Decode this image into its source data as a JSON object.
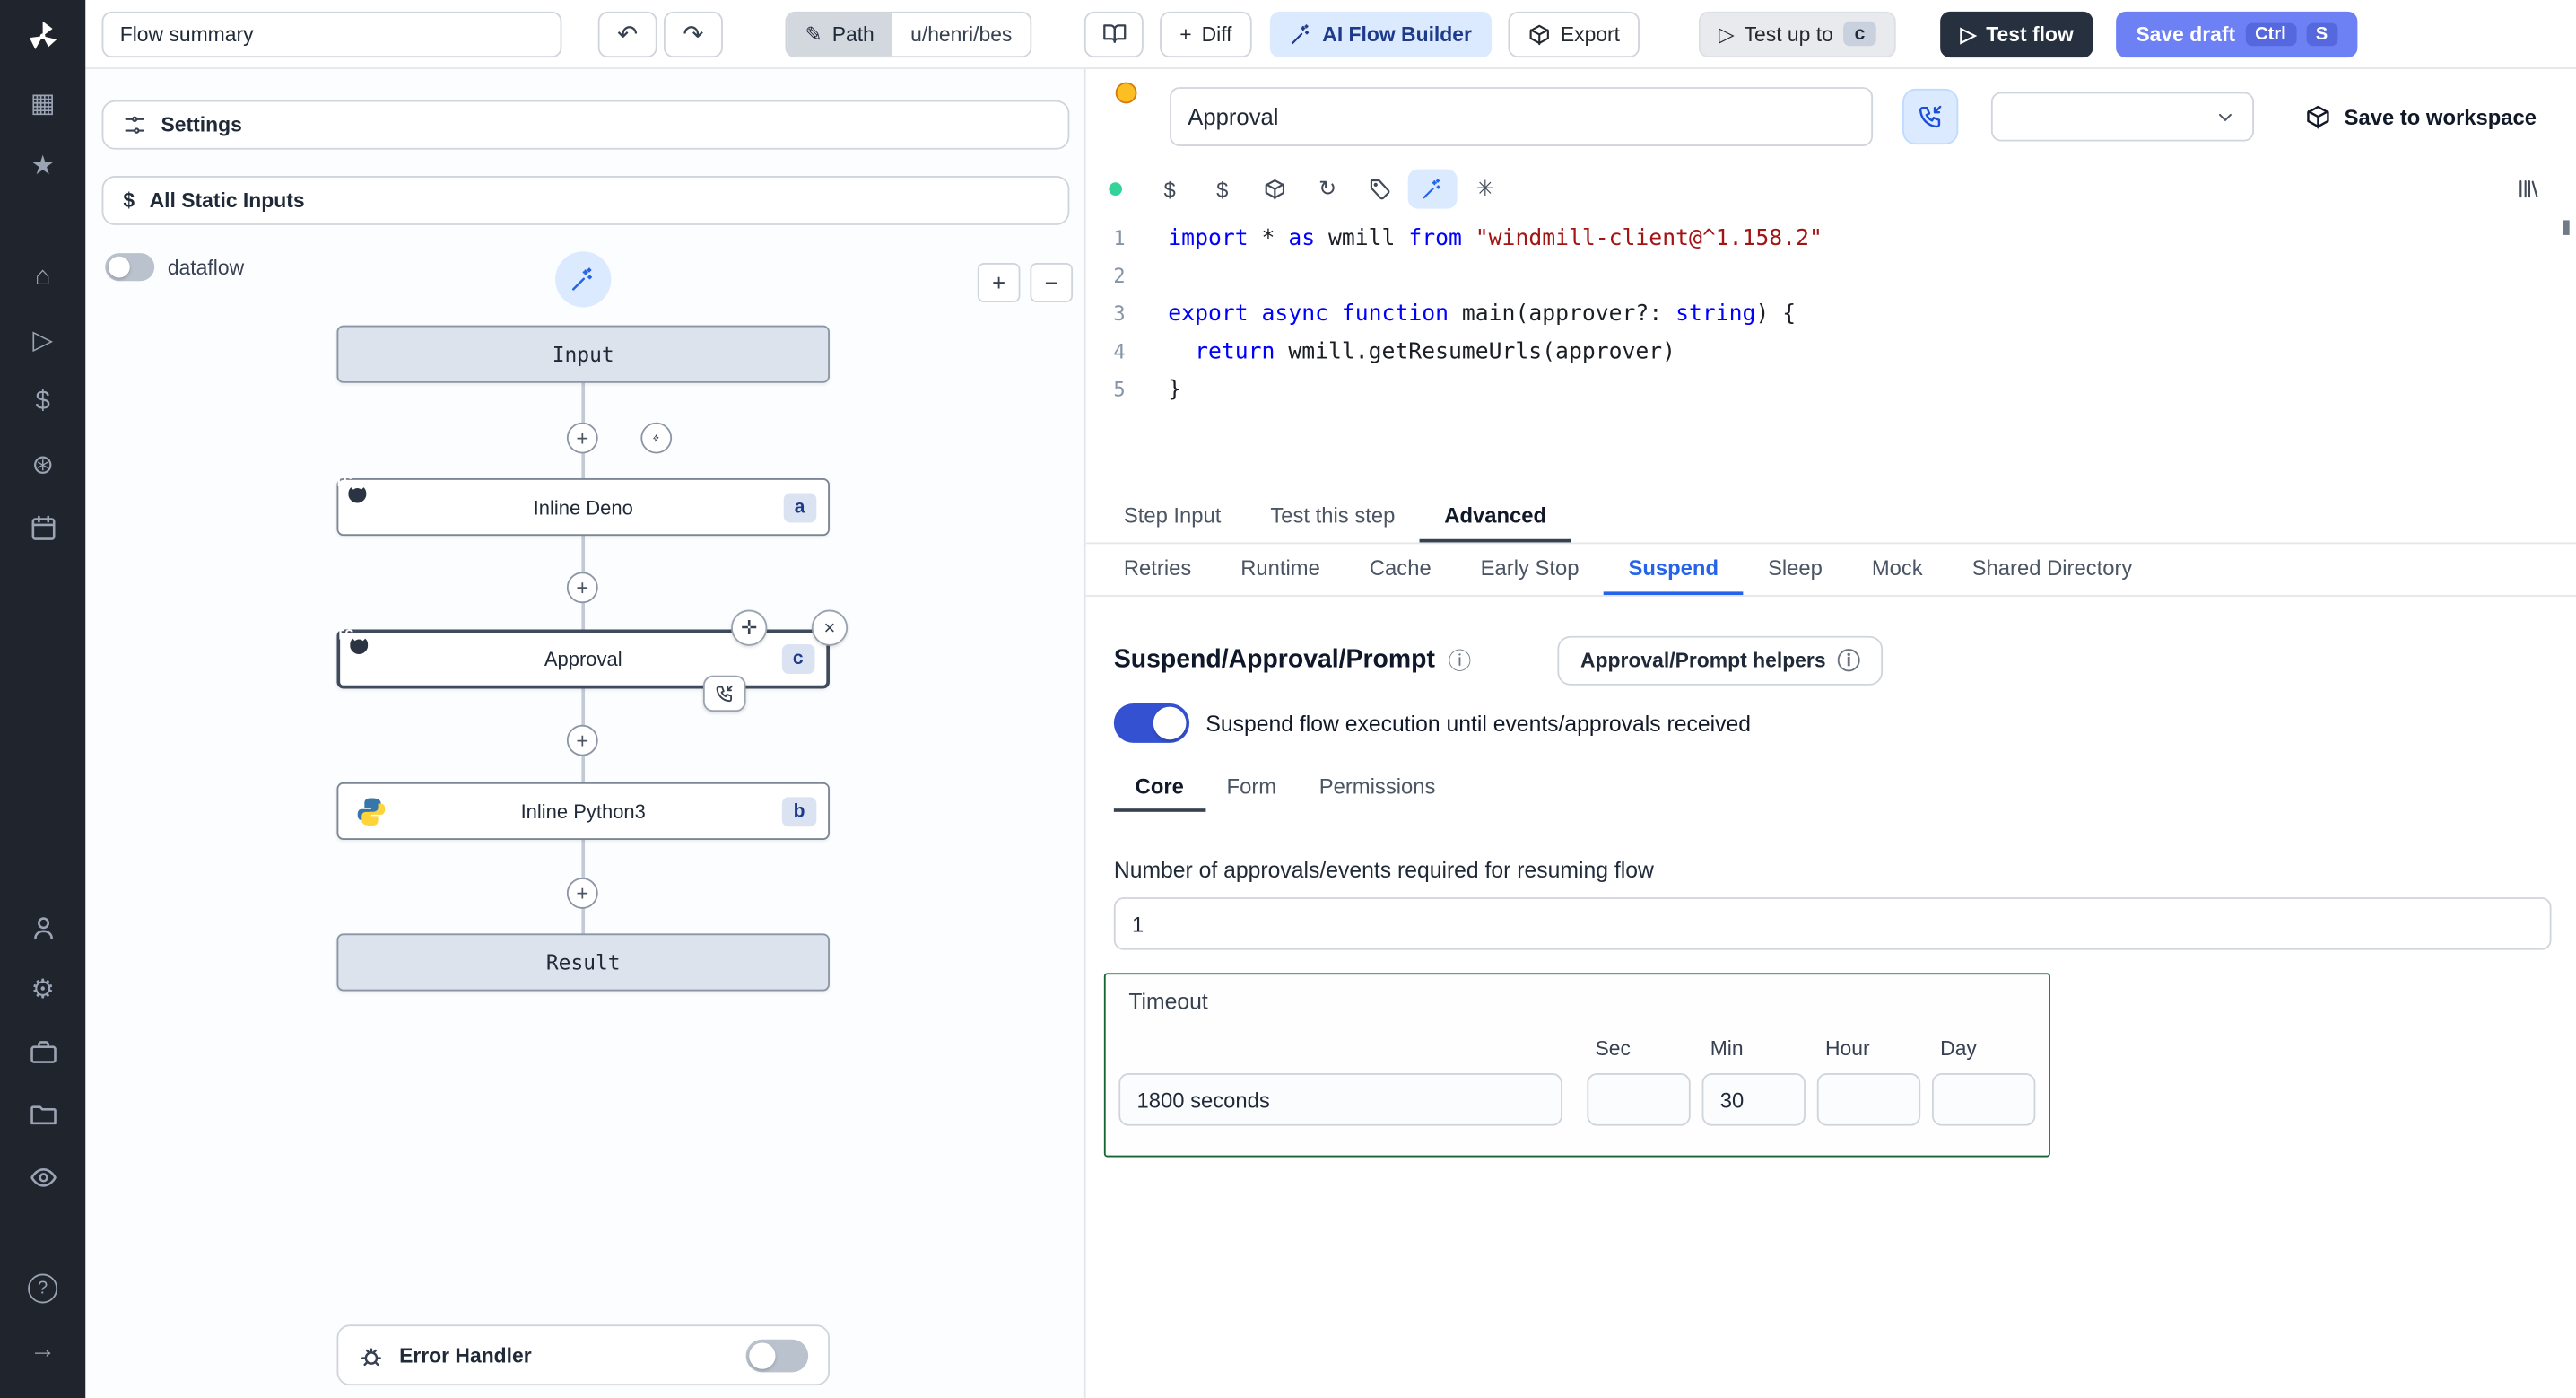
{
  "icons": {
    "undo": "↶",
    "redo": "↷",
    "pencil": "✎",
    "plus": "+",
    "minus": "−",
    "close": "×",
    "move": "✛",
    "grid": "▦",
    "star": "★",
    "home": "⌂",
    "play": "▷",
    "dollar": "$",
    "hub": "⊛",
    "gear": "⚙",
    "help": "?",
    "arrow_right": "→",
    "refresh": "↻",
    "asterisk": "✳",
    "info": "ⓘ",
    "ts": "TS"
  },
  "topbar": {
    "flow_summary": "Flow summary",
    "path_label": "Path",
    "path_value": "u/henri/bes",
    "diff_label": "Diff",
    "ai_builder_label": "AI Flow Builder",
    "export_label": "Export",
    "test_up_to_label": "Test up to",
    "test_up_to_badge": "c",
    "test_flow_label": "Test flow",
    "save_draft_label": "Save draft",
    "kbd_ctrl": "Ctrl",
    "kbd_s": "S"
  },
  "flow_panel": {
    "settings_label": "Settings",
    "static_inputs_label": "All Static Inputs",
    "dataflow_label": "dataflow",
    "input_node": "Input",
    "steps": [
      {
        "label": "Inline Deno",
        "badge": "a"
      },
      {
        "label": "Approval",
        "badge": "c"
      },
      {
        "label": "Inline Python3",
        "badge": "b"
      }
    ],
    "result_node": "Result",
    "error_handler_label": "Error Handler"
  },
  "step_header": {
    "name": "Approval",
    "save_label": "Save to workspace"
  },
  "editor": {
    "lines": [
      {
        "n": "1",
        "tokens": [
          [
            "k",
            "import"
          ],
          [
            "p",
            " * "
          ],
          [
            "k",
            "as"
          ],
          [
            "p",
            " wmill "
          ],
          [
            "k",
            "from"
          ],
          [
            "s",
            " \"windmill-client@^1.158.2\""
          ]
        ]
      },
      {
        "n": "2",
        "tokens": []
      },
      {
        "n": "3",
        "tokens": [
          [
            "k",
            "export"
          ],
          [
            "p",
            " "
          ],
          [
            "k",
            "async"
          ],
          [
            "p",
            " "
          ],
          [
            "k",
            "function"
          ],
          [
            "p",
            " main(approver?: "
          ],
          [
            "k",
            "string"
          ],
          [
            "p",
            ") {"
          ]
        ]
      },
      {
        "n": "4",
        "tokens": [
          [
            "p",
            "  "
          ],
          [
            "k",
            "return"
          ],
          [
            "p",
            " wmill.getResumeUrls(approver)"
          ]
        ]
      },
      {
        "n": "5",
        "tokens": [
          [
            "p",
            "}"
          ]
        ]
      }
    ]
  },
  "tabs": {
    "items": [
      "Step Input",
      "Test this step",
      "Advanced"
    ]
  },
  "subtabs": {
    "items": [
      "Retries",
      "Runtime",
      "Cache",
      "Early Stop",
      "Suspend",
      "Sleep",
      "Mock",
      "Shared Directory"
    ]
  },
  "suspend": {
    "title": "Suspend/Approval/Prompt",
    "helpers_label": "Approval/Prompt helpers",
    "toggle_label": "Suspend flow execution until events/approvals received",
    "tabs": [
      "Core",
      "Form",
      "Permissions"
    ],
    "approvals_label": "Number of approvals/events required for resuming flow",
    "approvals_value": "1",
    "timeout": {
      "legend": "Timeout",
      "seconds_value": "1800 seconds",
      "labels": [
        "Sec",
        "Min",
        "Hour",
        "Day"
      ],
      "sec_value": "",
      "min_value": "30",
      "hour_value": "",
      "day_value": ""
    }
  }
}
